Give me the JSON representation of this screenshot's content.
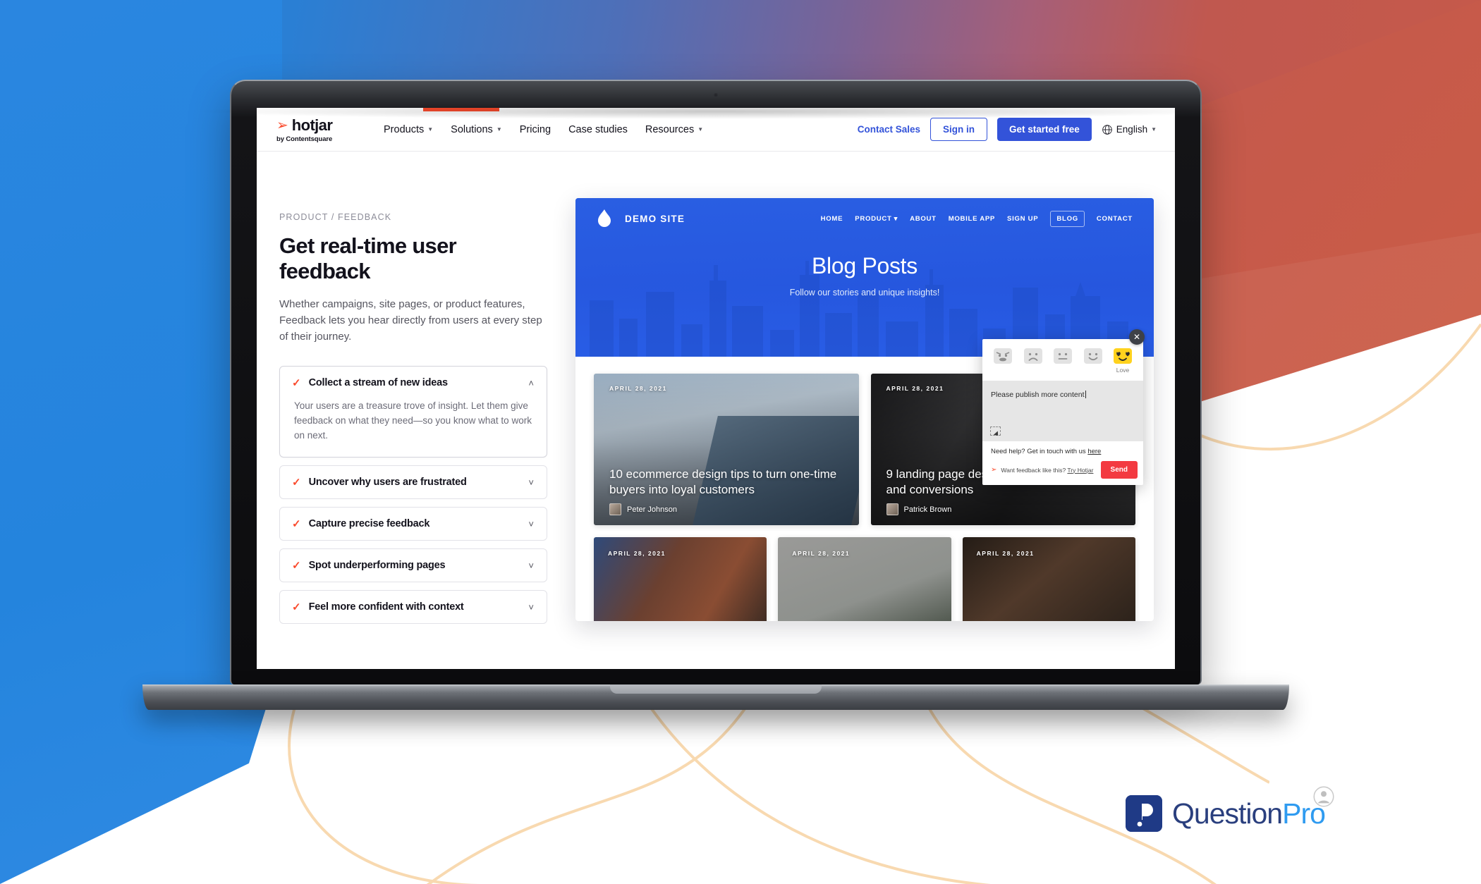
{
  "background": {
    "person_icon": "person-icon"
  },
  "hotjar": {
    "logo": {
      "name": "hotjar",
      "tagline": "by Contentsquare",
      "flame_icon": "flame-icon"
    },
    "nav_items": [
      {
        "label": "Products",
        "has_caret": true
      },
      {
        "label": "Solutions",
        "has_caret": true
      },
      {
        "label": "Pricing",
        "has_caret": false
      },
      {
        "label": "Case studies",
        "has_caret": false
      },
      {
        "label": "Resources",
        "has_caret": true
      }
    ],
    "contact_sales": "Contact Sales",
    "sign_in": "Sign in",
    "get_started": "Get started free",
    "language": "English",
    "globe_icon": "globe-icon",
    "accent_color": "#fa4a2c",
    "brand_blue": "#3353d9"
  },
  "hero": {
    "eyebrow": "PRODUCT / FEEDBACK",
    "title": "Get real-time user feedback",
    "subtitle": "Whether campaigns, site pages, or product features, Feedback lets you hear directly from users at every step of their journey."
  },
  "accordion": [
    {
      "title": "Collect a stream of new ideas",
      "body": "Your users are a treasure trove of insight. Let them give feedback on what they need—so you know what to work on next.",
      "open": true,
      "chevron": "˄"
    },
    {
      "title": "Uncover why users are frustrated",
      "body": "",
      "open": false,
      "chevron": "˅"
    },
    {
      "title": "Capture precise feedback",
      "body": "",
      "open": false,
      "chevron": "˅"
    },
    {
      "title": "Spot underperforming pages",
      "body": "",
      "open": false,
      "chevron": "˅"
    },
    {
      "title": "Feel more confident with context",
      "body": "",
      "open": false,
      "chevron": "˅"
    }
  ],
  "demo_site": {
    "brand": "DEMO SITE",
    "flame_icon": "flame-icon",
    "nav": [
      {
        "label": "HOME",
        "caret": false,
        "boxed": false
      },
      {
        "label": "PRODUCT",
        "caret": true,
        "boxed": false
      },
      {
        "label": "ABOUT",
        "caret": false,
        "boxed": false
      },
      {
        "label": "MOBILE APP",
        "caret": false,
        "boxed": false
      },
      {
        "label": "SIGN UP",
        "caret": false,
        "boxed": false
      },
      {
        "label": "BLOG",
        "caret": false,
        "boxed": true
      },
      {
        "label": "CONTACT",
        "caret": false,
        "boxed": false
      }
    ],
    "hero_title": "Blog Posts",
    "hero_subtitle": "Follow our stories and unique insights!",
    "posts": [
      {
        "date": "APRIL 28, 2021",
        "title": "10 ecommerce design tips to turn one-time buyers into loyal customers",
        "author": "Peter Johnson"
      },
      {
        "date": "APRIL 28, 2021",
        "title": "9 landing page design tips that improve UX and conversions",
        "author": "Patrick Brown"
      }
    ],
    "posts_small": [
      {
        "date": "APRIL 28, 2021"
      },
      {
        "date": "APRIL 28, 2021"
      },
      {
        "date": "APRIL 28, 2021"
      }
    ]
  },
  "feedback_widget": {
    "close_icon": "close-icon",
    "emojis": [
      {
        "name": "angry-emoji",
        "label": "",
        "selected": false
      },
      {
        "name": "sad-emoji",
        "label": "",
        "selected": false
      },
      {
        "name": "neutral-emoji",
        "label": "",
        "selected": false
      },
      {
        "name": "happy-emoji",
        "label": "",
        "selected": false
      },
      {
        "name": "love-emoji",
        "label": "Love",
        "selected": true
      }
    ],
    "selected_label": "Love",
    "comment": "Please publish more content",
    "selector_icon": "region-select-icon",
    "help_text": "Need help? Get in touch with us ",
    "help_link": "here",
    "promo_text": "Want feedback like this? ",
    "promo_link": "Try Hotjar",
    "promo_flame_icon": "flame-icon",
    "send_label": "Send",
    "send_color": "#f33a41",
    "selected_emoji_color": "#ffd21e"
  },
  "questionpro": {
    "mark_icon": "questionpro-mark-icon",
    "word_first": "Question",
    "word_second": "Pro",
    "color_dark": "#2a3f7e",
    "color_light": "#2f9bf0"
  }
}
